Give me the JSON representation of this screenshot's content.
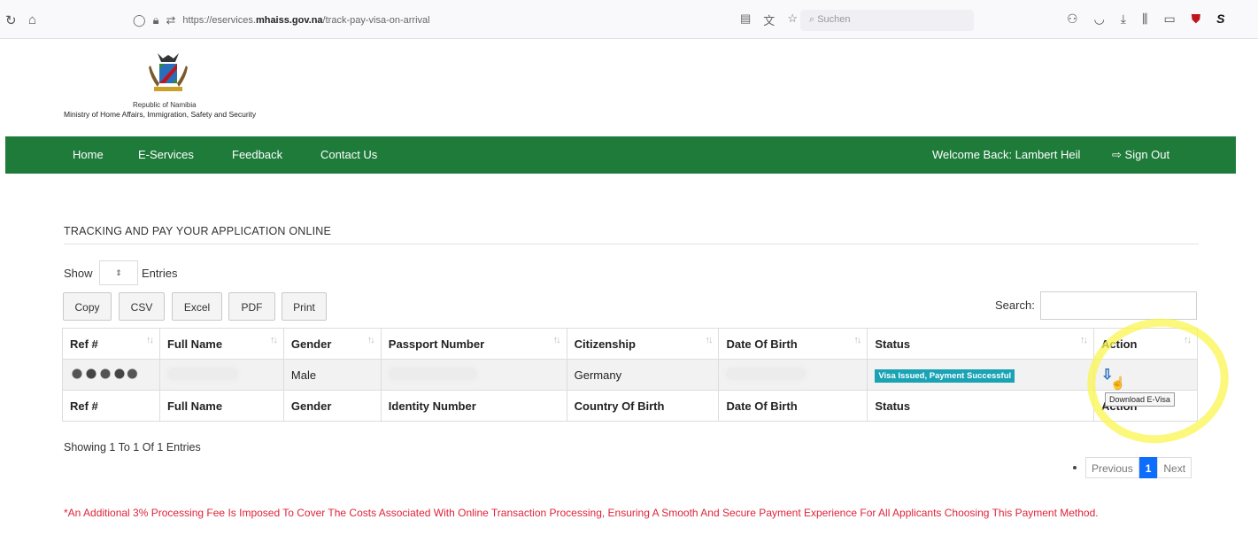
{
  "browser": {
    "back_icon": "reload-icon",
    "home_icon": "home-icon",
    "url_prefix": "https://eservices.",
    "url_domain": "mhaiss.gov.na",
    "url_path": "/track-pay-visa-on-arrival",
    "search_placeholder": "Suchen"
  },
  "header": {
    "republic": "Republic of Namibia",
    "ministry": "Ministry of Home Affairs, Immigration, Safety and Security"
  },
  "navbar": {
    "home": "Home",
    "eservices": "E-Services",
    "feedback": "Feedback",
    "contact": "Contact Us",
    "welcome": "Welcome Back: Lambert Heil",
    "signout": "Sign Out",
    "color": "#1e7b3a"
  },
  "page": {
    "title": "TRACKING AND PAY YOUR APPLICATION ONLINE",
    "show_label": "Show",
    "entries_label": "Entries",
    "buttons": {
      "copy": "Copy",
      "csv": "CSV",
      "excel": "Excel",
      "pdf": "PDF",
      "print": "Print"
    },
    "search_label": "Search:"
  },
  "table": {
    "headers": {
      "ref": "Ref #",
      "name": "Full Name",
      "gender": "Gender",
      "passport": "Passport Number",
      "citizenship": "Citizenship",
      "dob": "Date Of Birth",
      "status": "Status",
      "action": "Action"
    },
    "row": {
      "gender": "Male",
      "citizenship": "Germany",
      "status": "Visa Issued, Payment Successful"
    },
    "footer": {
      "ref": "Ref #",
      "name": "Full Name",
      "gender": "Gender",
      "identity": "Identity Number",
      "country": "Country Of Birth",
      "dob": "Date Of Birth",
      "status": "Status",
      "action": "Action"
    },
    "tooltip": "Download E-Visa"
  },
  "showing": "Showing 1 To 1 Of 1 Entries",
  "pagination": {
    "previous": "Previous",
    "current": "1",
    "next": "Next"
  },
  "fee_note": "*An Additional 3% Processing Fee Is Imposed To Cover The Costs Associated With Online Transaction Processing, Ensuring A Smooth And Secure Payment Experience For All Applicants Choosing This Payment Method."
}
